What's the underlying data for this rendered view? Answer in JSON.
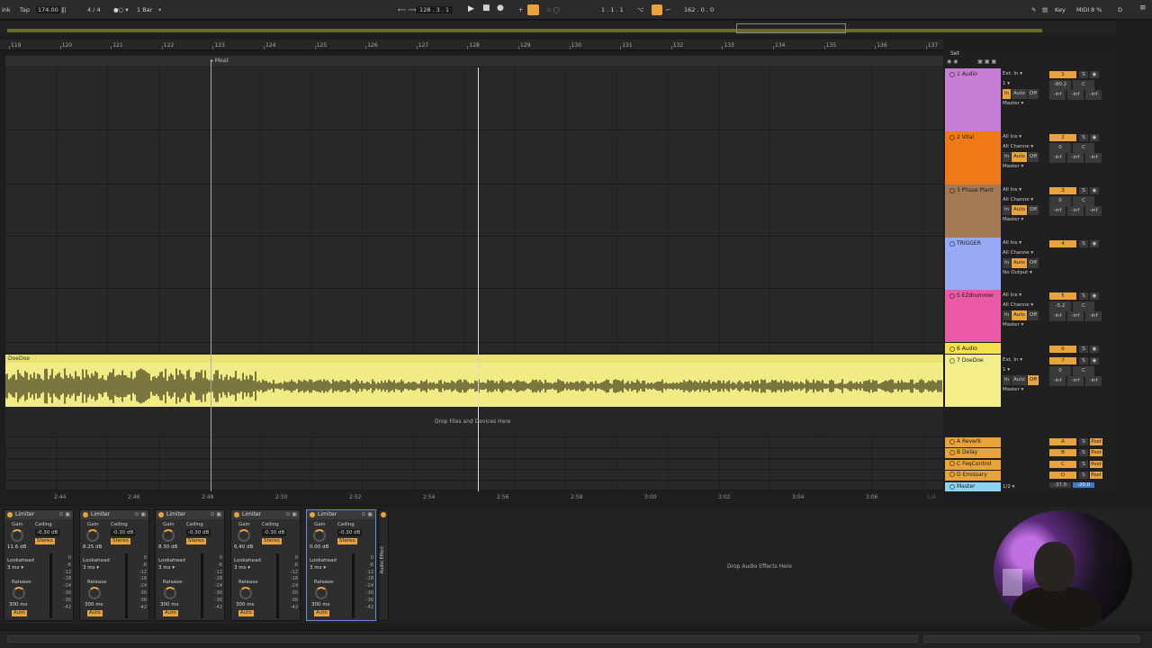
{
  "transport": {
    "link": "ink",
    "tap": "Tap",
    "tempo": "174.00",
    "signature": "4 / 4",
    "quantize": "1 Bar",
    "position": "128 .  3 .  1",
    "loop_start": "1 .  1 .  1",
    "loop_length": "162 .  0 .  0",
    "key": "Key",
    "midi": "MIDI",
    "cpu": "8 %",
    "d": "D"
  },
  "ruler": {
    "bars": [
      "119",
      "120",
      "121",
      "122",
      "123",
      "124",
      "125",
      "126",
      "127",
      "128",
      "129",
      "130",
      "131",
      "132",
      "133",
      "134",
      "135",
      "136",
      "137"
    ]
  },
  "locator": {
    "label": "Meat"
  },
  "time_ruler": {
    "times": [
      "2:44",
      "2:46",
      "2:48",
      "2:50",
      "2:52",
      "2:54",
      "2:56",
      "2:58",
      "3:00",
      "3:02",
      "3:04",
      "3:06"
    ],
    "zoom": "1/4"
  },
  "clip": {
    "name": "DoeDoe"
  },
  "drop_files": "Drop Files and Devices Here",
  "set_label": "Set",
  "tracks": [
    {
      "name": "1 Audio",
      "color": "#c77fd6",
      "input": "Ext. In",
      "input_channel": "1",
      "monitor": [
        "In",
        "Auto",
        "Off"
      ],
      "monitor_active": 0,
      "output": "Master",
      "number": "1",
      "volume": "-80.2",
      "pan": "C",
      "sends": [
        "-inf",
        "-inf",
        "-inf"
      ],
      "extra": "-inf"
    },
    {
      "name": "2 Vital",
      "color": "#f07a1a",
      "input": "All Ins",
      "input_channel": "All Channe",
      "monitor": [
        "In",
        "Auto",
        "Off"
      ],
      "monitor_active": 1,
      "output": "Master",
      "number": "2",
      "volume": "0",
      "pan": "C",
      "sends": [
        "-inf",
        "-inf",
        "-inf"
      ],
      "extra": "-inf"
    },
    {
      "name": "3 Phase Plant",
      "color": "#a47a55",
      "input": "All Ins",
      "input_channel": "All Channe",
      "monitor": [
        "In",
        "Auto",
        "Off"
      ],
      "monitor_active": 1,
      "output": "Master",
      "number": "3",
      "volume": "0",
      "pan": "C",
      "sends": [
        "-inf",
        "-inf",
        "-inf"
      ],
      "extra": "-inf"
    },
    {
      "name": "TRIGGER",
      "color": "#98aaf5",
      "input": "All Ins",
      "input_channel": "All Channe",
      "monitor": [
        "In",
        "Auto",
        "Off"
      ],
      "monitor_active": 1,
      "output": "No Output",
      "number": "4",
      "volume": "",
      "pan": "",
      "sends": [],
      "extra": ""
    },
    {
      "name": "5 EZdrummer",
      "color": "#ea5aa6",
      "input": "All Ins",
      "input_channel": "All Channe",
      "monitor": [
        "In",
        "Auto",
        "Off"
      ],
      "monitor_active": 1,
      "output": "Master",
      "number": "5",
      "volume": "-5.2",
      "pan": "C",
      "sends": [
        "-inf",
        "-inf",
        "-inf"
      ],
      "extra": "-inf"
    },
    {
      "name": "6 Audio",
      "color": "#f3e04a",
      "number": "6"
    },
    {
      "name": "7 DoeDoe",
      "color": "#f3ee8a",
      "input": "Ext. In",
      "input_channel": "1",
      "monitor": [
        "In",
        "Auto",
        "Off"
      ],
      "monitor_active": 2,
      "output": "Master",
      "number": "7",
      "volume": "0",
      "pan": "C",
      "sends": [
        "-inf",
        "-inf",
        "-inf"
      ],
      "extra": "-inf"
    }
  ],
  "returns": [
    {
      "name": "A Reverb",
      "letter": "A",
      "post": "Post"
    },
    {
      "name": "B Delay",
      "letter": "B",
      "post": "Post"
    },
    {
      "name": "C FeqControl",
      "letter": "C",
      "post": "Post"
    },
    {
      "name": "D Emissary",
      "letter": "D",
      "post": "Post"
    }
  ],
  "master": {
    "name": "Master",
    "cue": "1/2",
    "volume": "-37.0",
    "pan": "-20.0"
  },
  "devices": [
    {
      "title": "Limiter",
      "gain": "11.6 dB",
      "ceiling": "-0.30 dB",
      "stereo": "Stereo",
      "lookahead": "3 ms",
      "release": "300 ms",
      "auto": "Auto"
    },
    {
      "title": "Limiter",
      "gain": "8.25 dB",
      "ceiling": "-0.30 dB",
      "stereo": "Stereo",
      "lookahead": "3 ms",
      "release": "300 ms",
      "auto": "Auto"
    },
    {
      "title": "Limiter",
      "gain": "8.30 dB",
      "ceiling": "-0.30 dB",
      "stereo": "Stereo",
      "lookahead": "3 ms",
      "release": "300 ms",
      "auto": "Auto"
    },
    {
      "title": "Limiter",
      "gain": "6.40 dB",
      "ceiling": "-0.30 dB",
      "stereo": "Stereo",
      "lookahead": "3 ms",
      "release": "300 ms",
      "auto": "Auto"
    },
    {
      "title": "Limiter",
      "gain": "0.00 dB",
      "ceiling": "-0.30 dB",
      "stereo": "Stereo",
      "lookahead": "3 ms",
      "release": "300 ms",
      "auto": "Auto"
    }
  ],
  "device_labels": {
    "gain": "Gain",
    "ceiling": "Ceiling",
    "lookahead": "Lookahead",
    "release": "Release",
    "scale": [
      "0",
      "-6",
      "-12",
      "-18",
      "-24",
      "-30",
      "-36",
      "-42"
    ]
  },
  "audio_effect_rack": "Audio Effect",
  "drop_audio_effects": "Drop Audio Effects Here",
  "colors": {
    "accent": "#e8a33c",
    "clip": "#f0eb84",
    "background": "#1d1d1d"
  }
}
